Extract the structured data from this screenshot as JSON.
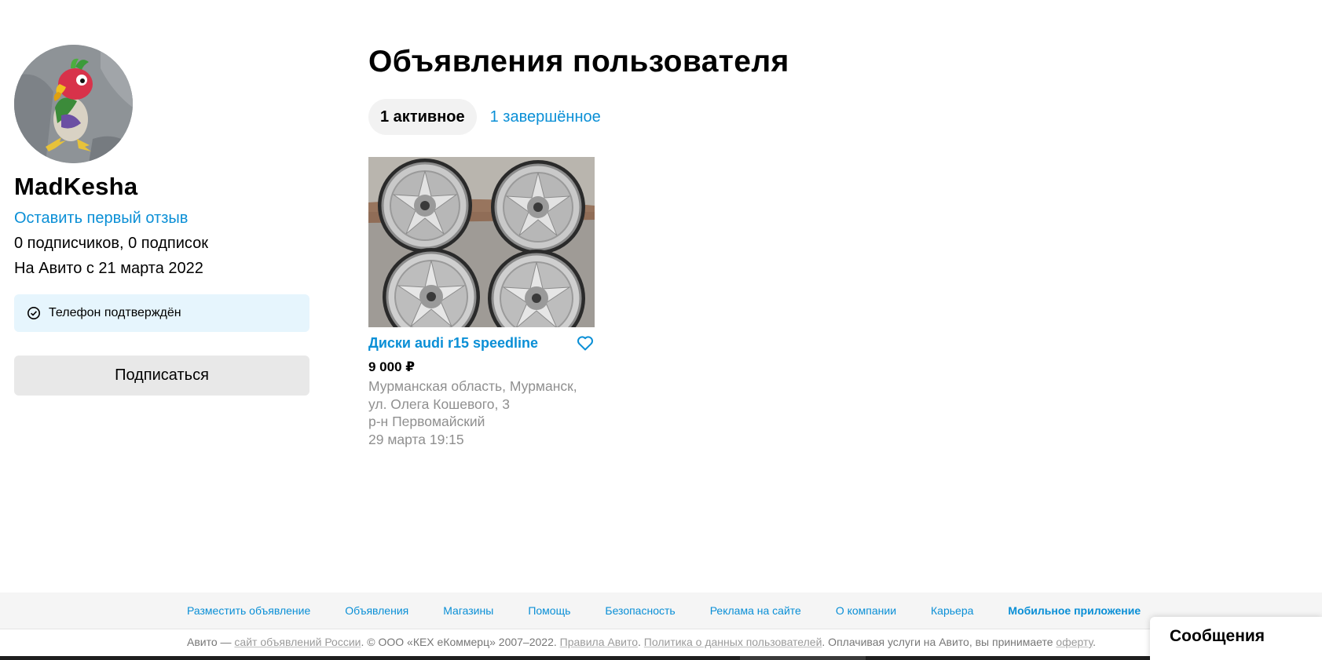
{
  "profile": {
    "name": "MadKesha",
    "review_link": "Оставить первый отзыв",
    "stats": "0 подписчиков, 0 подписок",
    "since": "На Авито с 21 марта 2022",
    "phone_badge": "Телефон подтверждён",
    "subscribe_label": "Подписаться"
  },
  "main": {
    "title": "Объявления пользователя",
    "tabs": [
      {
        "label": "1 активное",
        "active": true
      },
      {
        "label": "1 завершённое",
        "active": false
      }
    ]
  },
  "listing": {
    "title": "Диски audi r15 speedline",
    "price": "9 000 ₽",
    "address": "Мурманская область, Мурманск, ул. Олега Кошевого, 3",
    "district": "р-н Первомайский",
    "date": "29 марта 19:15"
  },
  "footer": {
    "links": [
      "Разместить объявление",
      "Объявления",
      "Магазины",
      "Помощь",
      "Безопасность",
      "Реклама на сайте",
      "О компании",
      "Карьера"
    ],
    "app_link": "Мобильное приложение",
    "copyright": {
      "prefix": "Авито — ",
      "site_link": "сайт объявлений России",
      "company": ". © ООО «КЕХ еКоммерц» 2007–2022. ",
      "rules_link": "Правила Авито",
      "sep": ". ",
      "privacy_link": "Политика о данных пользователей",
      "text_mid": ". Оплачивая услуги на Авито, вы принимаете ",
      "offer_link": "оферту",
      "suffix": "."
    }
  },
  "messages_widget": {
    "label": "Сообщения"
  },
  "colors": {
    "link": "#0a8fd6",
    "phone_badge_bg": "#e6f5fd",
    "button_bg": "#e8e8e8",
    "footer_bg": "#f5f5f5"
  },
  "icons": {
    "phone_badge": "check-circle-icon",
    "favorite": "heart-icon"
  }
}
